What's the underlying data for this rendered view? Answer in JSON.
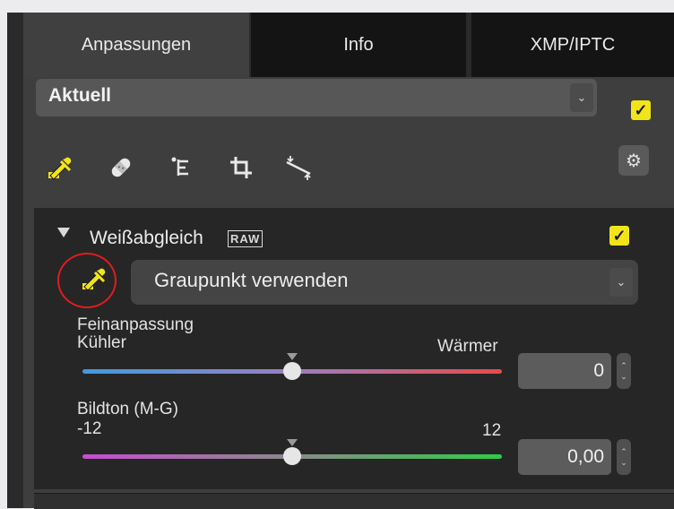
{
  "tabs": [
    {
      "label": "Anpassungen",
      "active": true
    },
    {
      "label": "Info",
      "active": false
    },
    {
      "label": "XMP/IPTC",
      "active": false
    }
  ],
  "preset": {
    "value": "Aktuell",
    "enabled": true
  },
  "toolbar": {
    "tools": [
      "eyedropper-icon",
      "bandage-icon",
      "levels-icon",
      "crop-icon",
      "straighten-icon"
    ],
    "settings": "gear-icon"
  },
  "white_balance": {
    "title": "Weißabgleich",
    "raw_badge": "RAW",
    "enabled": true,
    "mode": "Graupunkt verwenden",
    "fine_tune": {
      "label": "Feinanpassung",
      "min_label": "Kühler",
      "max_label": "Wärmer",
      "value": "0",
      "position": 0.5
    },
    "tint": {
      "label": "Bildton (M-G)",
      "min_label": "-12",
      "max_label": "12",
      "value": "0,00",
      "position": 0.5
    }
  },
  "colors": {
    "accent": "#f2e41b",
    "highlight_ring": "#e11c1c",
    "temp_gradient": [
      "#3f9be0",
      "#e84a4a"
    ],
    "tint_gradient": [
      "#c44fcf",
      "#2ecc46"
    ]
  }
}
